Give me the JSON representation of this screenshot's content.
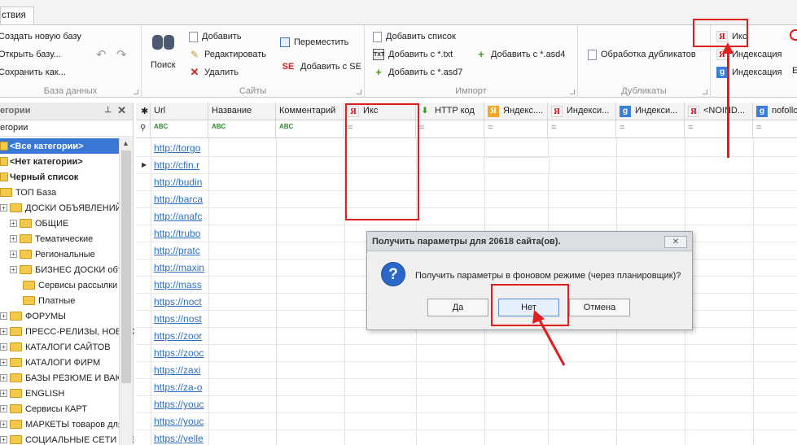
{
  "tabs": {
    "active_label": "ствия"
  },
  "ribbon": {
    "db_group": {
      "title": "База данных",
      "create_new": "Создать новую базу",
      "open": "Открыть базу...",
      "save_as": "Сохранить как..."
    },
    "sites_group": {
      "title": "Сайты",
      "search": "Поиск",
      "add": "Добавить",
      "edit": "Редактировать",
      "delete": "Удалить",
      "move": "Переместить",
      "add_se": "Добавить с SE"
    },
    "import_group": {
      "title": "Импорт",
      "add_list": "Добавить список",
      "add_txt": "Добавить с *.txt",
      "add_asd4": "Добавить с *.asd4",
      "add_asd7": "Добавить с *.asd7"
    },
    "duplicates_group": {
      "title": "Дубликаты",
      "process": "Обработка дубликатов"
    },
    "params_group": {
      "iks": "Икс",
      "ya_index": "Индексация",
      "g_index": "Индексация"
    }
  },
  "sidebar": {
    "header": "егории",
    "search_value": "егории",
    "items": [
      {
        "label": "<Все категории>"
      },
      {
        "label": "<Нет категории>"
      },
      {
        "label": "Черный список"
      },
      {
        "label": "ТОП База"
      },
      {
        "label": "ДОСКИ ОБЪЯВЛЕНИЙ"
      },
      {
        "label": "ОБЩИЕ"
      },
      {
        "label": "Тематические"
      },
      {
        "label": "Региональные"
      },
      {
        "label": "БИЗНЕС ДОСКИ объ"
      },
      {
        "label": "Сервисы рассылки"
      },
      {
        "label": "Платные"
      },
      {
        "label": "ФОРУМЫ"
      },
      {
        "label": "ПРЕСС-РЕЛИЗЫ, НОВОС"
      },
      {
        "label": "КАТАЛОГИ САЙТОВ"
      },
      {
        "label": "КАТАЛОГИ ФИРМ"
      },
      {
        "label": "БАЗЫ РЕЗЮМЕ И ВАКАН"
      },
      {
        "label": "ENGLISH"
      },
      {
        "label": "Сервисы КАРТ"
      },
      {
        "label": "МАРКЕТЫ товаров для"
      },
      {
        "label": "СОЦИАЛЬНЫЕ СЕТИ И Е"
      }
    ]
  },
  "grid": {
    "columns": [
      {
        "label": "Url"
      },
      {
        "label": "Название"
      },
      {
        "label": "Комментарий"
      },
      {
        "label": "Икс"
      },
      {
        "label": "HTTP код"
      },
      {
        "label": "Яндекс...."
      },
      {
        "label": "Индекси..."
      },
      {
        "label": "Индекси..."
      },
      {
        "label": "<NOIND..."
      },
      {
        "label": "nofollo"
      }
    ],
    "filter_abc": "ABC",
    "filter_eq": "=",
    "rows": [
      {
        "url": "http://torgo"
      },
      {
        "url": "http://cfin.r"
      },
      {
        "url": "http://budin"
      },
      {
        "url": "http://barca"
      },
      {
        "url": "http://anafc"
      },
      {
        "url": "http://trubo"
      },
      {
        "url": "http://pratc"
      },
      {
        "url": "http://maxin"
      },
      {
        "url": "http://mass"
      },
      {
        "url": "https://noct"
      },
      {
        "url": "https://nost"
      },
      {
        "url": "https://zoor"
      },
      {
        "url": "https://zooc"
      },
      {
        "url": "https://zaxi"
      },
      {
        "url": "https://za-o"
      },
      {
        "url": "https://youc"
      },
      {
        "url": "https://youc"
      },
      {
        "url": "https://yelle"
      }
    ]
  },
  "dialog": {
    "title": "Получить параметры для 20618 сайта(ов).",
    "message": "Получить параметры в фоновом режиме (через планировщик)?",
    "yes": "Да",
    "no": "Нет",
    "cancel": "Отмена",
    "close": "✕",
    "question_mark": "?"
  },
  "colors": {
    "annotation_red": "#e01e1e",
    "selection_blue": "#3a78d6"
  }
}
